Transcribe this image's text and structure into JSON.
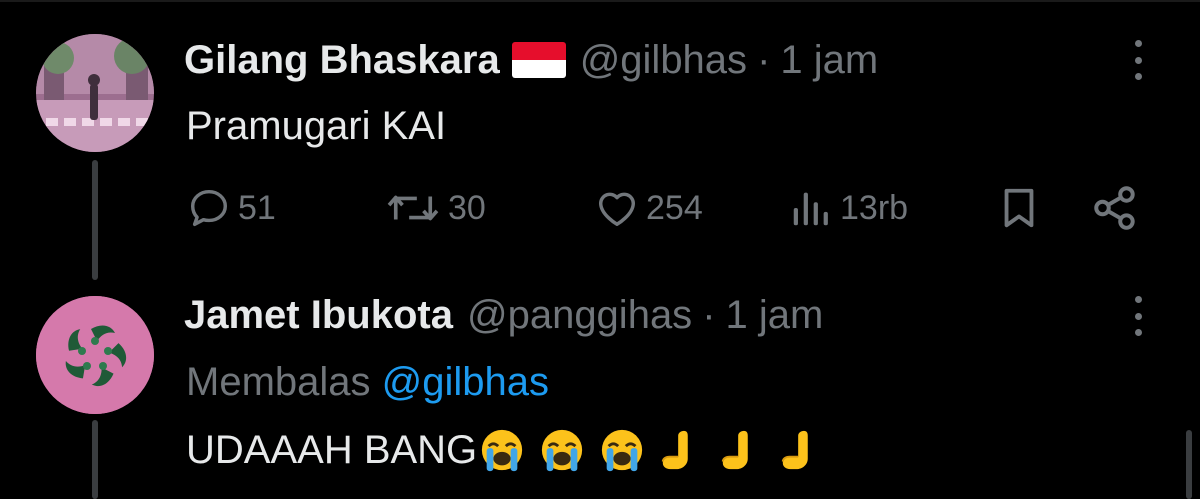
{
  "tweet": {
    "author_name": "Gilang Bhaskara",
    "flag_icon": "indonesia-flag-icon",
    "handle": "@gilbhas",
    "separator": "·",
    "time": "1 jam",
    "text": "Pramugari KAI",
    "stats": {
      "replies": "51",
      "reposts": "30",
      "likes": "254",
      "views": "13rb"
    }
  },
  "reply": {
    "author_name": "Jamet Ibukota",
    "handle": "@panggihas",
    "separator": "·",
    "time": "1 jam",
    "replying_label": "Membalas",
    "replying_to": "@gilbhas",
    "text": "UDAAAH BANG",
    "emojis": [
      "loudly-crying-face",
      "loudly-crying-face",
      "loudly-crying-face",
      "raised-hand-sideways",
      "raised-hand-sideways",
      "raised-hand-sideways"
    ]
  },
  "colors": {
    "background": "#000000",
    "text_primary": "#e7e9ea",
    "text_secondary": "#71767b",
    "link": "#1d9bf0",
    "avatar2_bg": "#d579ab",
    "avatar1_tint": "#c58fb3"
  }
}
